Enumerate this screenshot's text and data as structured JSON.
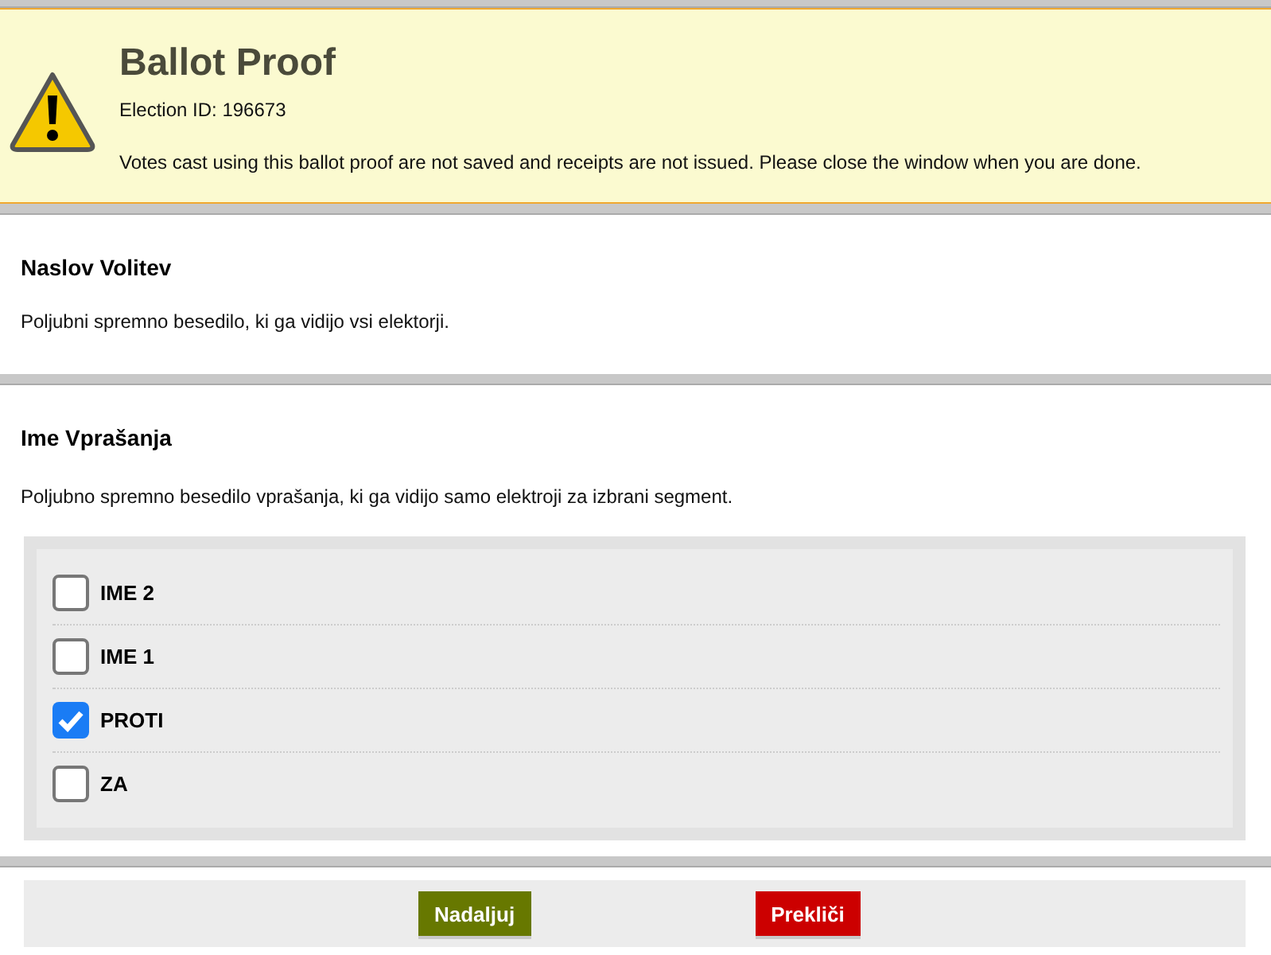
{
  "banner": {
    "title": "Ballot Proof",
    "election_id": "Election ID: 196673",
    "notice": "Votes cast using this ballot proof are not saved and receipts are not issued. Please close the window when you are done."
  },
  "election": {
    "title": "Naslov Volitev",
    "description": "Poljubni spremno besedilo, ki ga vidijo vsi elektorji."
  },
  "question": {
    "title": "Ime Vprašanja",
    "description": "Poljubno spremno besedilo vprašanja, ki ga vidijo samo elektroji za izbrani segment.",
    "options": [
      {
        "label": "IME 2",
        "checked": false
      },
      {
        "label": "IME 1",
        "checked": false
      },
      {
        "label": "PROTI",
        "checked": true
      },
      {
        "label": "ZA",
        "checked": false
      }
    ]
  },
  "buttons": [
    {
      "label": "Nadaljuj",
      "kind": "continue"
    },
    {
      "label": "Prekliči",
      "kind": "cancel"
    }
  ]
}
